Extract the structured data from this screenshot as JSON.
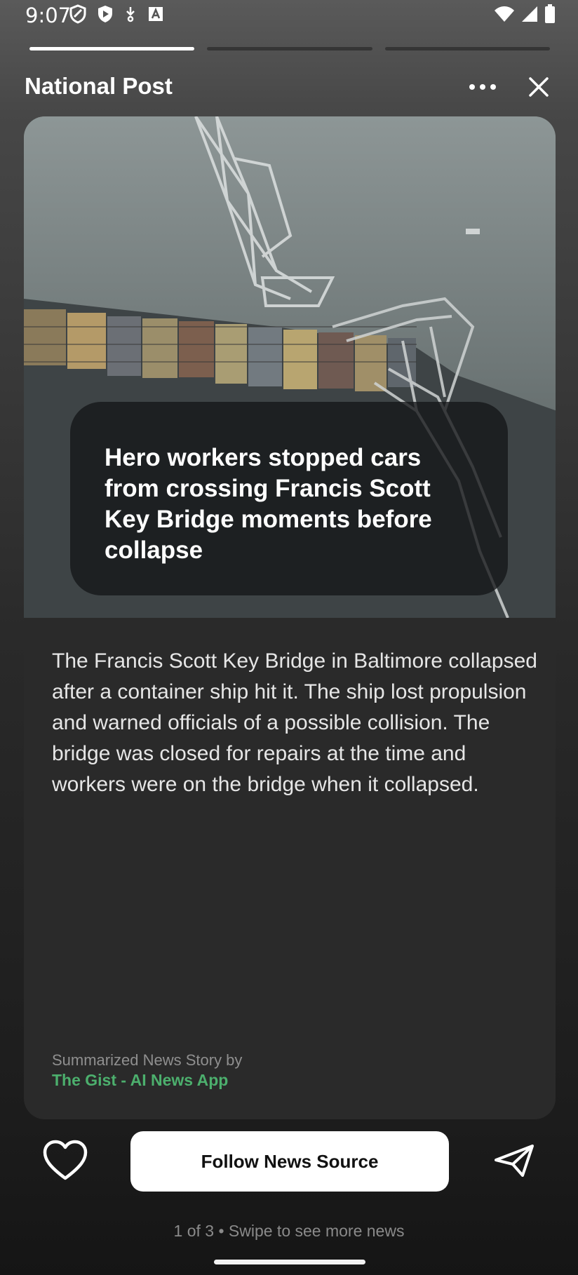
{
  "status_bar": {
    "time": "9:07",
    "left_icons": [
      "shield-outline-icon",
      "shield-play-icon",
      "download-icon",
      "app-a-icon"
    ],
    "right_icons": [
      "wifi-icon",
      "cellular-signal-icon",
      "battery-icon"
    ]
  },
  "story_progress": {
    "total": 3,
    "current": 1
  },
  "header": {
    "source_name": "National Post",
    "more_icon": "more-horizontal-icon",
    "close_icon": "close-icon"
  },
  "story": {
    "headline": "Hero workers stopped cars from crossing Francis Scott Key Bridge moments before collapse",
    "summary": "The Francis Scott Key Bridge in Baltimore collapsed after a container ship hit it. The ship lost propulsion and warned officials of a possible collision. The bridge was closed for repairs at the time and workers were on the bridge when it collapsed.",
    "credit_prefix": "Summarized News Story by",
    "credit_app": "The Gist - AI News App",
    "image_subject": "aerial photo of collapsed bridge on container ship"
  },
  "actions": {
    "like_icon": "heart-outline-icon",
    "follow_label": "Follow News Source",
    "share_icon": "send-icon"
  },
  "footer": {
    "hint": "1 of 3 • Swipe to see more news"
  },
  "colors": {
    "accent_green": "#4caf6d",
    "card_bg": "#2a2a2a",
    "button_bg": "#ffffff"
  }
}
